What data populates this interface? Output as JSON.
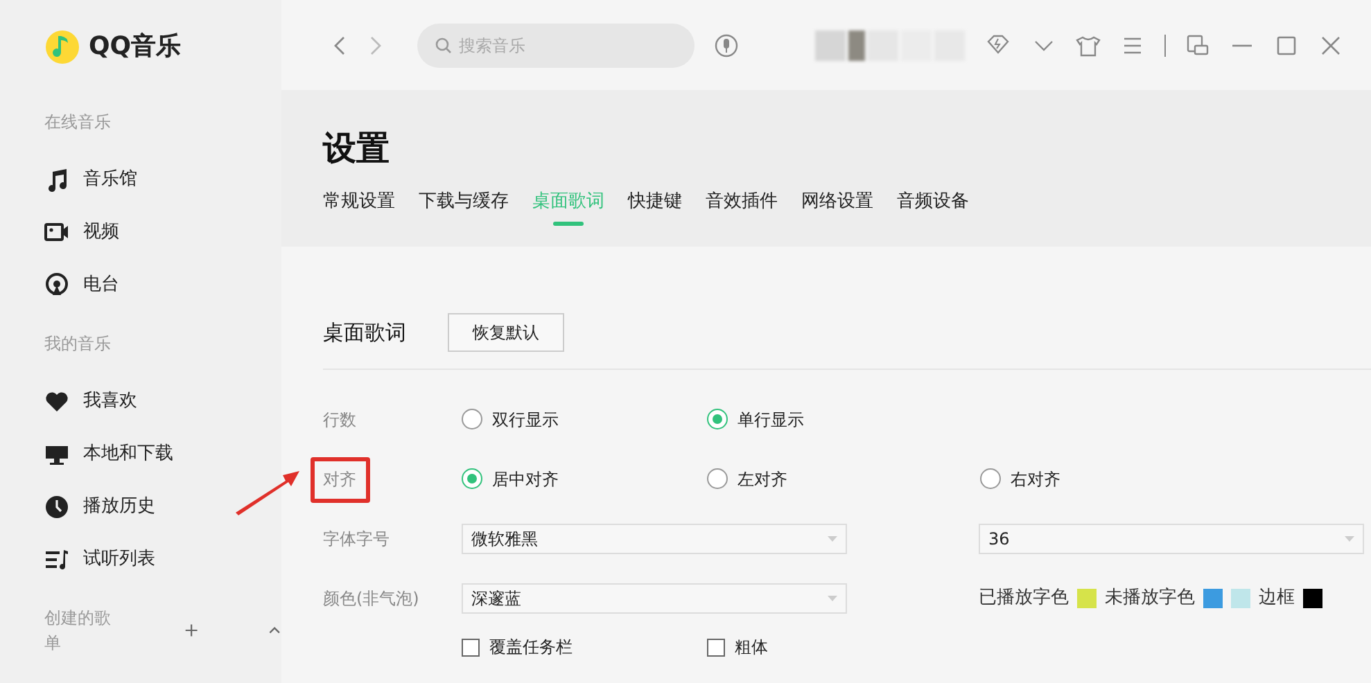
{
  "app": {
    "name": "QQ音乐"
  },
  "sidebar": [
    {
      "heading": "在线音乐",
      "items": [
        {
          "label": "音乐馆"
        },
        {
          "label": "视频"
        },
        {
          "label": "电台"
        }
      ]
    },
    {
      "heading": "我的音乐",
      "items": [
        {
          "label": "我喜欢"
        },
        {
          "label": "本地和下载"
        },
        {
          "label": "播放历史"
        },
        {
          "label": "试听列表"
        }
      ]
    },
    {
      "heading": "创建的歌单"
    }
  ],
  "search": {
    "placeholder": "搜索音乐"
  },
  "page": {
    "title": "设置"
  },
  "tabs": [
    {
      "label": "常规设置",
      "selected": false
    },
    {
      "label": "下载与缓存",
      "selected": false
    },
    {
      "label": "桌面歌词",
      "selected": true
    },
    {
      "label": "快捷键",
      "selected": false
    },
    {
      "label": "音效插件",
      "selected": false
    },
    {
      "label": "网络设置",
      "selected": false
    },
    {
      "label": "音频设备",
      "selected": false
    }
  ],
  "section": {
    "title": "桌面歌词",
    "reset_button": "恢复默认"
  },
  "rows": [
    {
      "kind": "radio",
      "label": "行数",
      "highlighted": false,
      "options": [
        {
          "label": "双行显示",
          "selected": false
        },
        {
          "label": "单行显示",
          "selected": true
        }
      ]
    },
    {
      "kind": "radio",
      "label": "对齐",
      "highlighted": true,
      "options": [
        {
          "label": "居中对齐",
          "selected": true
        },
        {
          "label": "左对齐",
          "selected": false
        },
        {
          "label": "右对齐",
          "selected": false
        }
      ]
    },
    {
      "kind": "font",
      "label": "字体字号",
      "font": "微软雅黑",
      "size": "36"
    },
    {
      "kind": "color",
      "label": "颜色(非气泡)",
      "scheme": "深邃蓝",
      "color_settings": [
        {
          "label": "已播放字色",
          "swatches": [
            {
              "color": "#d6e34a"
            }
          ]
        },
        {
          "label": "未播放字色",
          "swatches": [
            {
              "color": "#3c9be0"
            },
            {
              "color": "#bfe6ea"
            }
          ]
        },
        {
          "label": "边框",
          "swatches": [
            {
              "color": "#000000"
            }
          ]
        }
      ]
    },
    {
      "kind": "checks",
      "options": [
        {
          "label": "覆盖任务栏",
          "checked": false
        },
        {
          "label": "粗体",
          "checked": false
        }
      ]
    }
  ]
}
